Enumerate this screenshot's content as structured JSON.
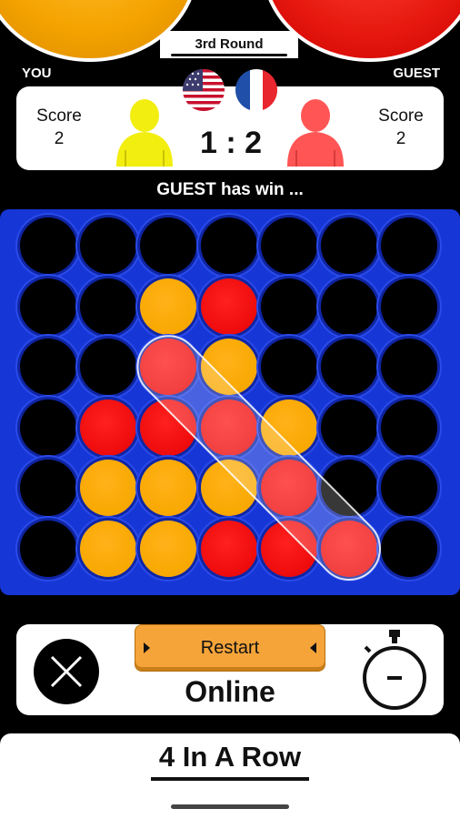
{
  "header": {
    "round_label": "3rd Round",
    "player_left": "YOU",
    "player_right": "GUEST"
  },
  "score_panel": {
    "left_score_label": "Score",
    "left_score_value": "2",
    "right_score_label": "Score",
    "right_score_value": "2",
    "match_score": "1 : 2"
  },
  "status_text": "GUEST has win ...",
  "board": {
    "rows": 6,
    "cols": 7,
    "grid": [
      [
        0,
        0,
        0,
        0,
        0,
        0,
        0
      ],
      [
        0,
        0,
        1,
        2,
        0,
        0,
        0
      ],
      [
        0,
        0,
        2,
        1,
        0,
        0,
        0
      ],
      [
        0,
        2,
        2,
        2,
        1,
        0,
        0
      ],
      [
        0,
        1,
        1,
        1,
        2,
        0,
        0
      ],
      [
        0,
        1,
        1,
        2,
        2,
        2,
        0
      ]
    ],
    "winning_line": [
      [
        2,
        2
      ],
      [
        3,
        3
      ],
      [
        4,
        4
      ],
      [
        5,
        5
      ]
    ],
    "colors": {
      "board": "#1636d6",
      "player1": "#f9a800",
      "player2": "#ee0b0b",
      "empty": "#000000"
    }
  },
  "controls": {
    "restart_label": "Restart",
    "mode_label": "Online"
  },
  "footer": {
    "title": "4 In A Row"
  },
  "icons": {
    "close": "close-icon",
    "timer": "stopwatch-icon",
    "flag_left": "usa-flag-icon",
    "flag_right": "france-flag-icon",
    "avatar_left": "yellow-player-icon",
    "avatar_right": "red-player-icon"
  }
}
